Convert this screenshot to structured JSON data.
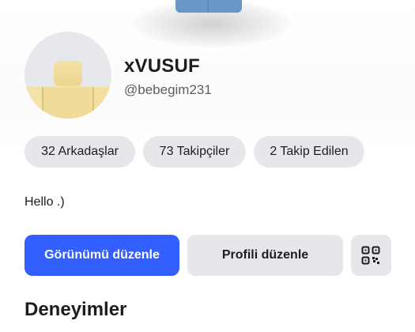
{
  "profile": {
    "display_name": "xVUSUF",
    "username": "@bebegim231",
    "bio": "Hello .)"
  },
  "stats": {
    "friends": "32 Arkadaşlar",
    "followers": "73 Takipçiler",
    "following": "2 Takip Edilen"
  },
  "actions": {
    "edit_avatar": "Görünümü düzenle",
    "edit_profile": "Profili düzenle",
    "qr_icon": "qr-code-icon"
  },
  "sections": {
    "experiences": "Deneyimler"
  },
  "colors": {
    "primary_button": "#335fff",
    "secondary_button": "#e5e7eb",
    "pill_background": "#e5e7eb"
  }
}
